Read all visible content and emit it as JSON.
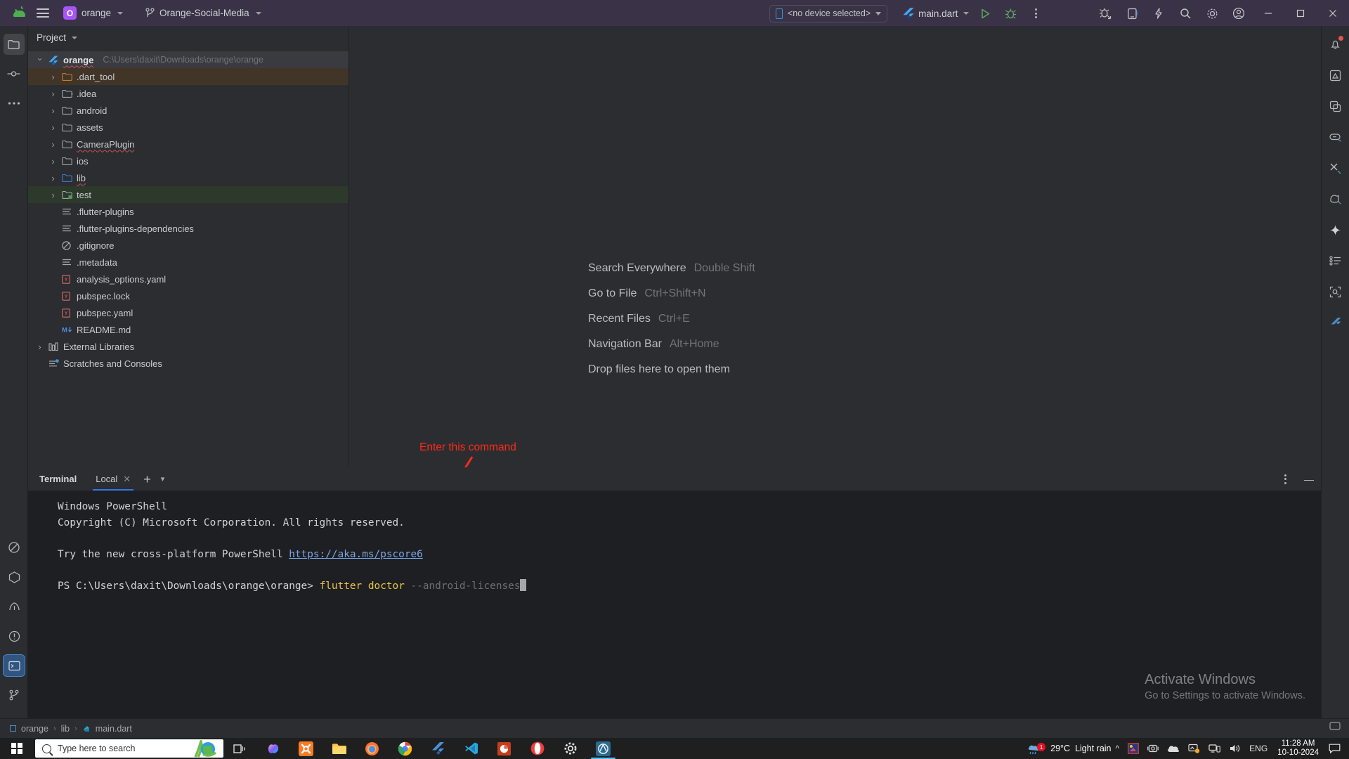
{
  "titlebar": {
    "android_icon": "android-logo-icon",
    "menu_icon": "hamburger-menu-icon",
    "project_badge": "O",
    "project_name": "orange",
    "branch_icon": "git-branch-icon",
    "branch_name": "Orange-Social-Media",
    "device_selector": "<no device selected>",
    "device_icon": "phone-icon",
    "run_config": "main.dart",
    "run_config_icon": "flutter-icon",
    "run_button": "run-icon",
    "debug_button": "debug-bug-icon",
    "more_button": "more-vertical-icon",
    "right_icons": [
      "debug-arrow-icon",
      "device-manager-icon",
      "lightning-icon",
      "search-icon",
      "settings-gear-icon",
      "account-icon"
    ],
    "window_minimize": "minimize-icon",
    "window_maximize": "maximize-icon",
    "window_close": "close-icon"
  },
  "left_strip": {
    "items": [
      {
        "name": "project-tool-icon",
        "label": "Project",
        "active": true
      },
      {
        "name": "commit-tool-icon",
        "label": "Commit",
        "active": false
      },
      {
        "name": "more-tool-icon",
        "label": "More Tool Windows",
        "active": false
      }
    ],
    "bottom_items": [
      {
        "name": "notifications-off-icon",
        "label": "Problems"
      },
      {
        "name": "flutter-inspector-icon",
        "label": "Flutter Inspector"
      },
      {
        "name": "flutter-performance-icon",
        "label": "Flutter Performance"
      },
      {
        "name": "problems-icon",
        "label": "Problems"
      },
      {
        "name": "terminal-icon",
        "label": "Terminal",
        "selected": true
      },
      {
        "name": "version-control-icon",
        "label": "Version Control"
      }
    ]
  },
  "right_strip": {
    "items": [
      {
        "name": "notifications-bell-icon",
        "badge": true
      },
      {
        "name": "ai-assistant-icon",
        "badge": false
      },
      {
        "name": "device-file-explorer-icon",
        "badge": false
      },
      {
        "name": "database-link-icon",
        "badge": false
      },
      {
        "name": "build-tools-icon",
        "badge": false
      },
      {
        "name": "gradle-icon",
        "badge": false
      },
      {
        "name": "sparkle-icon",
        "badge": false
      },
      {
        "name": "structure-list-icon",
        "badge": false
      },
      {
        "name": "profiler-search-icon",
        "badge": false
      },
      {
        "name": "flutter-outline-icon",
        "badge": false
      }
    ]
  },
  "project_panel": {
    "header": "Project",
    "header_chevron": "chevron-down-icon",
    "tree": [
      {
        "indent": 0,
        "arrow": "open",
        "icon": "flutter-icon",
        "label": "orange",
        "path": "C:\\Users\\daxit\\Downloads\\orange\\orange",
        "style": "root",
        "bold": true,
        "squiggle": true
      },
      {
        "indent": 1,
        "arrow": "closed",
        "icon": "folder-orange-icon",
        "label": ".dart_tool",
        "path": "",
        "style": "hl-brown"
      },
      {
        "indent": 1,
        "arrow": "closed",
        "icon": "folder-idea-icon",
        "label": ".idea",
        "path": "",
        "style": ""
      },
      {
        "indent": 1,
        "arrow": "closed",
        "icon": "folder-icon",
        "label": "android",
        "path": "",
        "style": ""
      },
      {
        "indent": 1,
        "arrow": "closed",
        "icon": "folder-icon",
        "label": "assets",
        "path": "",
        "style": ""
      },
      {
        "indent": 1,
        "arrow": "closed",
        "icon": "folder-icon",
        "label": "CameraPlugin",
        "path": "",
        "style": "",
        "squiggle": true
      },
      {
        "indent": 1,
        "arrow": "closed",
        "icon": "folder-icon",
        "label": "ios",
        "path": "",
        "style": ""
      },
      {
        "indent": 1,
        "arrow": "closed",
        "icon": "folder-blue-icon",
        "label": "lib",
        "path": "",
        "style": "",
        "squiggle": true
      },
      {
        "indent": 1,
        "arrow": "closed",
        "icon": "folder-test-icon",
        "label": "test",
        "path": "",
        "style": "hl-green"
      },
      {
        "indent": 1,
        "arrow": "none",
        "icon": "text-file-icon",
        "label": ".flutter-plugins",
        "path": "",
        "style": ""
      },
      {
        "indent": 1,
        "arrow": "none",
        "icon": "text-file-icon",
        "label": ".flutter-plugins-dependencies",
        "path": "",
        "style": ""
      },
      {
        "indent": 1,
        "arrow": "none",
        "icon": "gitignore-icon",
        "label": ".gitignore",
        "path": "",
        "style": ""
      },
      {
        "indent": 1,
        "arrow": "none",
        "icon": "text-file-icon",
        "label": ".metadata",
        "path": "",
        "style": ""
      },
      {
        "indent": 1,
        "arrow": "none",
        "icon": "yaml-file-icon",
        "label": "analysis_options.yaml",
        "path": "",
        "style": ""
      },
      {
        "indent": 1,
        "arrow": "none",
        "icon": "yaml-file-icon",
        "label": "pubspec.lock",
        "path": "",
        "style": ""
      },
      {
        "indent": 1,
        "arrow": "none",
        "icon": "yaml-file-icon",
        "label": "pubspec.yaml",
        "path": "",
        "style": ""
      },
      {
        "indent": 1,
        "arrow": "none",
        "icon": "markdown-file-icon",
        "label": "README.md",
        "path": "",
        "style": ""
      },
      {
        "indent": 0,
        "arrow": "closed",
        "icon": "library-icon",
        "label": "External Libraries",
        "path": "",
        "style": ""
      },
      {
        "indent": 0,
        "arrow": "none",
        "icon": "scratches-icon",
        "label": "Scratches and Consoles",
        "path": "",
        "style": ""
      }
    ]
  },
  "editor": {
    "hints": [
      {
        "action": "Search Everywhere",
        "shortcut": "Double Shift"
      },
      {
        "action": "Go to File",
        "shortcut": "Ctrl+Shift+N"
      },
      {
        "action": "Recent Files",
        "shortcut": "Ctrl+E"
      },
      {
        "action": "Navigation Bar",
        "shortcut": "Alt+Home"
      },
      {
        "action": "Drop files here to open them",
        "shortcut": ""
      }
    ]
  },
  "annotation": {
    "text": "Enter this command",
    "color": "#ff2a18"
  },
  "terminal": {
    "title": "Terminal",
    "tab_label": "Local",
    "tab_close_icon": "close-icon",
    "add_icon": "plus-icon",
    "dropdown_icon": "chevron-down-icon",
    "options_icon": "more-vertical-icon",
    "minimize_icon": "minimize-icon",
    "lines": [
      {
        "type": "plain",
        "text": "Windows PowerShell"
      },
      {
        "type": "plain",
        "text": "Copyright (C) Microsoft Corporation. All rights reserved."
      },
      {
        "type": "blank",
        "text": ""
      },
      {
        "type": "link_line",
        "prefix": "Try the new cross-platform PowerShell ",
        "link": "https://aka.ms/pscore6"
      },
      {
        "type": "blank",
        "text": ""
      },
      {
        "type": "prompt",
        "prompt": "PS C:\\Users\\daxit\\Downloads\\orange\\orange> ",
        "cmd": "flutter doctor",
        "args": " --android-licenses"
      }
    ]
  },
  "watermark": {
    "title": "Activate Windows",
    "subtitle": "Go to Settings to activate Windows."
  },
  "statusbar": {
    "breadcrumb": [
      "orange",
      "lib",
      "main.dart"
    ],
    "separator": "›",
    "right_icon": "event-log-icon"
  },
  "taskbar": {
    "start_icon": "windows-start-icon",
    "search_placeholder": "Type here to search",
    "search_icon": "search-icon",
    "ribbon_icon": "cancer-ribbon-globe-icon",
    "apps": [
      {
        "name": "task-view-icon"
      },
      {
        "name": "copilot-icon"
      },
      {
        "name": "xampp-icon"
      },
      {
        "name": "file-explorer-icon"
      },
      {
        "name": "firefox-icon"
      },
      {
        "name": "chrome-icon"
      },
      {
        "name": "flutter-icon"
      },
      {
        "name": "vscode-icon"
      },
      {
        "name": "powerpoint-icon"
      },
      {
        "name": "opera-icon"
      },
      {
        "name": "settings-icon"
      },
      {
        "name": "android-studio-icon",
        "active": true
      }
    ],
    "tray": {
      "weather_temp": "29°C",
      "weather_desc": "Light rain",
      "weather_badge": "1",
      "chevron_icon": "chevron-up-icon",
      "icons": [
        "paint-icon",
        "webcam-icon",
        "onedrive-icon",
        "screen-icon",
        "network-icon",
        "volume-icon"
      ],
      "language": "ENG",
      "time": "11:28 AM",
      "date": "10-10-2024",
      "action_center_icon": "notification-icon"
    }
  }
}
